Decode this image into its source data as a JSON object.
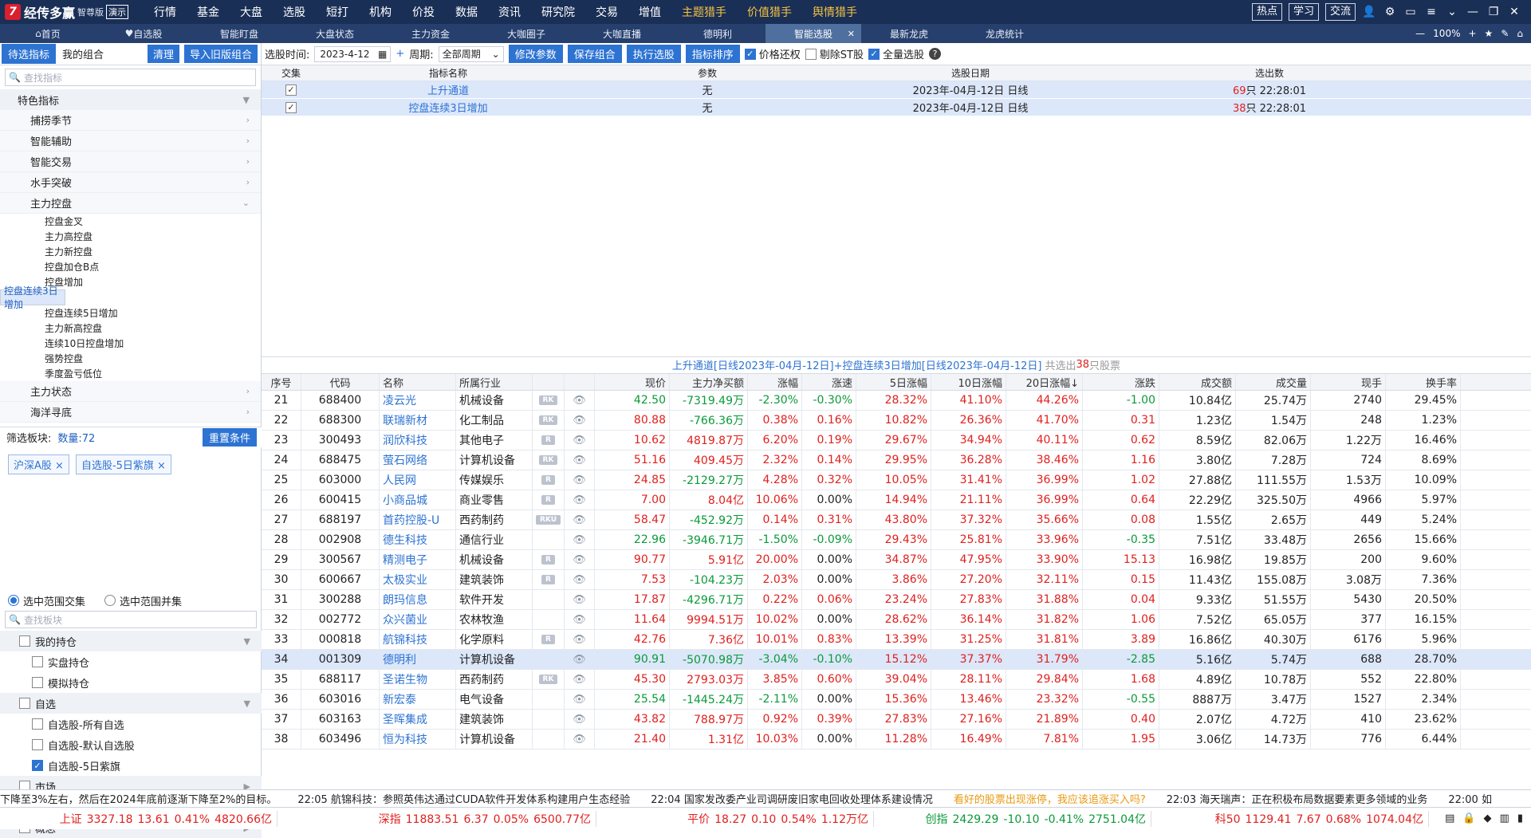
{
  "app": {
    "logo_text": "经传多赢",
    "edition": "智尊版",
    "demo": "演示"
  },
  "menu": [
    {
      "label": "行情",
      "gold": false
    },
    {
      "label": "基金",
      "gold": false
    },
    {
      "label": "大盘",
      "gold": false
    },
    {
      "label": "选股",
      "gold": false
    },
    {
      "label": "短打",
      "gold": false
    },
    {
      "label": "机构",
      "gold": false
    },
    {
      "label": "价投",
      "gold": false
    },
    {
      "label": "数据",
      "gold": false
    },
    {
      "label": "资讯",
      "gold": false
    },
    {
      "label": "研究院",
      "gold": false
    },
    {
      "label": "交易",
      "gold": false
    },
    {
      "label": "增值",
      "gold": false
    },
    {
      "label": "主题猎手",
      "gold": true
    },
    {
      "label": "价值猎手",
      "gold": true
    },
    {
      "label": "舆情猎手",
      "gold": true
    }
  ],
  "top_buttons": [
    "热点",
    "学习",
    "交流"
  ],
  "tabs": [
    {
      "label": "首页",
      "active": false
    },
    {
      "label": "自选股",
      "active": false
    },
    {
      "label": "智能盯盘",
      "active": false
    },
    {
      "label": "大盘状态",
      "active": false
    },
    {
      "label": "主力资金",
      "active": false
    },
    {
      "label": "大咖圈子",
      "active": false
    },
    {
      "label": "大咖直播",
      "active": false
    },
    {
      "label": "德明利",
      "active": false
    },
    {
      "label": "智能选股",
      "active": true
    },
    {
      "label": "最新龙虎",
      "active": false
    },
    {
      "label": "龙虎统计",
      "active": false
    }
  ],
  "zoom": "100%",
  "left": {
    "tabs": [
      "待选指标",
      "我的组合"
    ],
    "buttons": [
      "清理",
      "导入旧版组合"
    ],
    "search_placeholder": "查找指标",
    "tree_top": "特色指标",
    "groups_before": [
      "捕捞季节",
      "智能辅助",
      "智能交易",
      "水手突破"
    ],
    "open_group": "主力控盘",
    "leaves": [
      {
        "label": "控盘金叉",
        "sel": false
      },
      {
        "label": "主力高控盘",
        "sel": false
      },
      {
        "label": "主力新控盘",
        "sel": false
      },
      {
        "label": "控盘加仓B点",
        "sel": false
      },
      {
        "label": "控盘增加",
        "sel": false
      },
      {
        "label": "控盘连续3日增加",
        "sel": true
      },
      {
        "label": "控盘连续5日增加",
        "sel": false
      },
      {
        "label": "主力新高控盘",
        "sel": false
      },
      {
        "label": "连续10日控盘增加",
        "sel": false
      },
      {
        "label": "强势控盘",
        "sel": false
      },
      {
        "label": "季度盈亏低位",
        "sel": false
      }
    ],
    "groups_after": [
      "主力状态",
      "海洋寻底"
    ],
    "filter_label": "筛选板块:",
    "filter_count": "数量:72",
    "reset": "重置条件",
    "tags": [
      "沪深A股",
      "自选股-5日紫旗"
    ],
    "radio1": "选中范围交集",
    "radio2": "选中范围并集",
    "search2_placeholder": "查找板块",
    "boards": [
      {
        "label": "我的持仓",
        "level": "top",
        "checked": false,
        "chev": "▼"
      },
      {
        "label": "实盘持仓",
        "level": "sub",
        "checked": false,
        "chev": ""
      },
      {
        "label": "模拟持仓",
        "level": "sub",
        "checked": false,
        "chev": ""
      },
      {
        "label": "自选",
        "level": "top",
        "checked": false,
        "chev": "▼"
      },
      {
        "label": "自选股-所有自选",
        "level": "sub",
        "checked": false,
        "chev": ""
      },
      {
        "label": "自选股-默认自选股",
        "level": "sub",
        "checked": false,
        "chev": ""
      },
      {
        "label": "自选股-5日紫旗",
        "level": "sub",
        "checked": true,
        "chev": ""
      },
      {
        "label": "市场",
        "level": "top",
        "checked": false,
        "chev": "▶"
      },
      {
        "label": "行业",
        "level": "top",
        "checked": false,
        "chev": "▶"
      },
      {
        "label": "概念",
        "level": "top",
        "checked": false,
        "chev": "▶"
      }
    ]
  },
  "toolbar": {
    "time_label": "选股时间:",
    "date": "2023-4-12",
    "period_label": "周期:",
    "period": "全部周期",
    "buttons": [
      "修改参数",
      "保存组合",
      "执行选股",
      "指标排序"
    ],
    "chk1": "价格还权",
    "chk2": "剔除ST股",
    "chk3": "全量选股"
  },
  "formula_head": [
    "交集",
    "指标名称",
    "参数",
    "选股日期",
    "选出数"
  ],
  "formulas": [
    {
      "name": "上升通道",
      "param": "无",
      "date": "2023年-04月-12日 日线",
      "count": "69",
      "unit": "只 22:28:01"
    },
    {
      "name": "控盘连续3日增加",
      "param": "无",
      "date": "2023年-04月-12日 日线",
      "count": "38",
      "unit": "只 22:28:01"
    }
  ],
  "cond": {
    "text": "上升通道[日线2023年-04月-12日]+控盘连续3日增加[日线2023年-04月-12日]",
    "pre": "共选出",
    "count": "38",
    "post": "只股票"
  },
  "grid_head": [
    "序号",
    "代码",
    "名称",
    "所属行业",
    "",
    "",
    "现价",
    "主力净买额",
    "涨幅",
    "涨速",
    "5日涨幅",
    "10日涨幅",
    "20日涨幅↓",
    "涨跌",
    "成交额",
    "成交量",
    "现手",
    "换手率"
  ],
  "rows": [
    {
      "n": "21",
      "code": "688400",
      "name": "凌云光",
      "ind": "机械设备",
      "badge": "RK",
      "price": "42.50",
      "net": "-7319.49万",
      "chg": "-2.30%",
      "spd": "-0.30%",
      "d5": "28.32%",
      "d10": "41.10%",
      "d20": "44.26%",
      "up": "-1.00",
      "amt": "10.84亿",
      "vol": "25.74万",
      "hand": "2740",
      "turn": "29.45%"
    },
    {
      "n": "22",
      "code": "688300",
      "name": "联瑞新材",
      "ind": "化工制品",
      "badge": "RK",
      "price": "80.88",
      "net": "-766.36万",
      "chg": "0.38%",
      "spd": "0.16%",
      "d5": "10.82%",
      "d10": "26.36%",
      "d20": "41.70%",
      "up": "0.31",
      "amt": "1.23亿",
      "vol": "1.54万",
      "hand": "248",
      "turn": "1.23%"
    },
    {
      "n": "23",
      "code": "300493",
      "name": "润欣科技",
      "ind": "其他电子",
      "badge": "R",
      "price": "10.62",
      "net": "4819.87万",
      "chg": "6.20%",
      "spd": "0.19%",
      "d5": "29.67%",
      "d10": "34.94%",
      "d20": "40.11%",
      "up": "0.62",
      "amt": "8.59亿",
      "vol": "82.06万",
      "hand": "1.22万",
      "turn": "16.46%"
    },
    {
      "n": "24",
      "code": "688475",
      "name": "萤石网络",
      "ind": "计算机设备",
      "badge": "RK",
      "price": "51.16",
      "net": "409.45万",
      "chg": "2.32%",
      "spd": "0.14%",
      "d5": "29.95%",
      "d10": "36.28%",
      "d20": "38.46%",
      "up": "1.16",
      "amt": "3.80亿",
      "vol": "7.28万",
      "hand": "724",
      "turn": "8.69%"
    },
    {
      "n": "25",
      "code": "603000",
      "name": "人民网",
      "ind": "传媒娱乐",
      "badge": "R",
      "price": "24.85",
      "net": "-2129.27万",
      "chg": "4.28%",
      "spd": "0.32%",
      "d5": "10.05%",
      "d10": "31.41%",
      "d20": "36.99%",
      "up": "1.02",
      "amt": "27.88亿",
      "vol": "111.55万",
      "hand": "1.53万",
      "turn": "10.09%"
    },
    {
      "n": "26",
      "code": "600415",
      "name": "小商品城",
      "ind": "商业零售",
      "badge": "R",
      "price": "7.00",
      "net": "8.04亿",
      "chg": "10.06%",
      "spd": "0.00%",
      "d5": "14.94%",
      "d10": "21.11%",
      "d20": "36.99%",
      "up": "0.64",
      "amt": "22.29亿",
      "vol": "325.50万",
      "hand": "4966",
      "turn": "5.97%"
    },
    {
      "n": "27",
      "code": "688197",
      "name": "首药控股-U",
      "ind": "西药制药",
      "badge": "RKU",
      "price": "58.47",
      "net": "-452.92万",
      "chg": "0.14%",
      "spd": "0.31%",
      "d5": "43.80%",
      "d10": "37.32%",
      "d20": "35.66%",
      "up": "0.08",
      "amt": "1.55亿",
      "vol": "2.65万",
      "hand": "449",
      "turn": "5.24%"
    },
    {
      "n": "28",
      "code": "002908",
      "name": "德生科技",
      "ind": "通信行业",
      "badge": "",
      "price": "22.96",
      "net": "-3946.71万",
      "chg": "-1.50%",
      "spd": "-0.09%",
      "d5": "29.43%",
      "d10": "25.81%",
      "d20": "33.96%",
      "up": "-0.35",
      "amt": "7.51亿",
      "vol": "33.48万",
      "hand": "2656",
      "turn": "15.66%"
    },
    {
      "n": "29",
      "code": "300567",
      "name": "精测电子",
      "ind": "机械设备",
      "badge": "R",
      "price": "90.77",
      "net": "5.91亿",
      "chg": "20.00%",
      "spd": "0.00%",
      "d5": "34.87%",
      "d10": "47.95%",
      "d20": "33.90%",
      "up": "15.13",
      "amt": "16.98亿",
      "vol": "19.85万",
      "hand": "200",
      "turn": "9.60%"
    },
    {
      "n": "30",
      "code": "600667",
      "name": "太极实业",
      "ind": "建筑装饰",
      "badge": "R",
      "price": "7.53",
      "net": "-104.23万",
      "chg": "2.03%",
      "spd": "0.00%",
      "d5": "3.86%",
      "d10": "27.20%",
      "d20": "32.11%",
      "up": "0.15",
      "amt": "11.43亿",
      "vol": "155.08万",
      "hand": "3.08万",
      "turn": "7.36%"
    },
    {
      "n": "31",
      "code": "300288",
      "name": "朗玛信息",
      "ind": "软件开发",
      "badge": "",
      "price": "17.87",
      "net": "-4296.71万",
      "chg": "0.22%",
      "spd": "0.06%",
      "d5": "23.24%",
      "d10": "27.83%",
      "d20": "31.88%",
      "up": "0.04",
      "amt": "9.33亿",
      "vol": "51.55万",
      "hand": "5430",
      "turn": "20.50%"
    },
    {
      "n": "32",
      "code": "002772",
      "name": "众兴菌业",
      "ind": "农林牧渔",
      "badge": "",
      "price": "11.64",
      "net": "9994.51万",
      "chg": "10.02%",
      "spd": "0.00%",
      "d5": "28.62%",
      "d10": "36.14%",
      "d20": "31.82%",
      "up": "1.06",
      "amt": "7.52亿",
      "vol": "65.05万",
      "hand": "377",
      "turn": "16.15%"
    },
    {
      "n": "33",
      "code": "000818",
      "name": "航锦科技",
      "ind": "化学原料",
      "badge": "R",
      "price": "42.76",
      "net": "7.36亿",
      "chg": "10.01%",
      "spd": "0.83%",
      "d5": "13.39%",
      "d10": "31.25%",
      "d20": "31.81%",
      "up": "3.89",
      "amt": "16.86亿",
      "vol": "40.30万",
      "hand": "6176",
      "turn": "5.96%"
    },
    {
      "n": "34",
      "code": "001309",
      "name": "德明利",
      "ind": "计算机设备",
      "badge": "",
      "price": "90.91",
      "net": "-5070.98万",
      "chg": "-3.04%",
      "spd": "-0.10%",
      "d5": "15.12%",
      "d10": "37.37%",
      "d20": "31.79%",
      "up": "-2.85",
      "amt": "5.16亿",
      "vol": "5.74万",
      "hand": "688",
      "turn": "28.70%",
      "hl": true
    },
    {
      "n": "35",
      "code": "688117",
      "name": "圣诺生物",
      "ind": "西药制药",
      "badge": "RK",
      "price": "45.30",
      "net": "2793.03万",
      "chg": "3.85%",
      "spd": "0.60%",
      "d5": "39.04%",
      "d10": "28.11%",
      "d20": "29.84%",
      "up": "1.68",
      "amt": "4.89亿",
      "vol": "10.78万",
      "hand": "552",
      "turn": "22.80%"
    },
    {
      "n": "36",
      "code": "603016",
      "name": "新宏泰",
      "ind": "电气设备",
      "badge": "",
      "price": "25.54",
      "net": "-1445.24万",
      "chg": "-2.11%",
      "spd": "0.00%",
      "d5": "15.36%",
      "d10": "13.46%",
      "d20": "23.32%",
      "up": "-0.55",
      "amt": "8887万",
      "vol": "3.47万",
      "hand": "1527",
      "turn": "2.34%"
    },
    {
      "n": "37",
      "code": "603163",
      "name": "圣晖集成",
      "ind": "建筑装饰",
      "badge": "",
      "price": "43.82",
      "net": "788.97万",
      "chg": "0.92%",
      "spd": "0.39%",
      "d5": "27.83%",
      "d10": "27.16%",
      "d20": "21.89%",
      "up": "0.40",
      "amt": "2.07亿",
      "vol": "4.72万",
      "hand": "410",
      "turn": "23.62%"
    },
    {
      "n": "38",
      "code": "603496",
      "name": "恒为科技",
      "ind": "计算机设备",
      "badge": "",
      "price": "21.40",
      "net": "1.31亿",
      "chg": "10.03%",
      "spd": "0.00%",
      "d5": "11.28%",
      "d10": "16.49%",
      "d20": "7.81%",
      "up": "1.95",
      "amt": "3.06亿",
      "vol": "14.73万",
      "hand": "776",
      "turn": "6.44%"
    }
  ],
  "news": [
    {
      "text": "下降至3%左右，然后在2024年底前逐渐下降至2%的目标。",
      "orange": false
    },
    {
      "text": "22:05 航锦科技：参照英伟达通过CUDA软件开发体系构建用户生态经验",
      "orange": false
    },
    {
      "text": "22:04 国家发改委产业司调研废旧家电回收处理体系建设情况",
      "orange": false
    },
    {
      "text": "看好的股票出现涨停，我应该追涨买入吗?",
      "orange": true
    },
    {
      "text": "22:03 海天瑞声：正在积极布局数据要素更多领域的业务",
      "orange": false
    },
    {
      "text": "22:00 如",
      "orange": false
    }
  ],
  "indices": [
    {
      "name": "上证",
      "val": "3327.18",
      "chg": "13.61",
      "pct": "0.41%",
      "amt": "4820.66亿"
    },
    {
      "name": "深指",
      "val": "11883.51",
      "chg": "6.37",
      "pct": "0.05%",
      "amt": "6500.77亿"
    },
    {
      "name": "平价",
      "val": "18.27",
      "chg": "0.10",
      "pct": "0.54%",
      "amt": "1.12万亿"
    },
    {
      "name": "创指",
      "val": "2429.29",
      "chg": "-10.10",
      "pct": "-0.41%",
      "amt": "2751.04亿"
    },
    {
      "name": "科50",
      "val": "1129.41",
      "chg": "7.67",
      "pct": "0.68%",
      "amt": "1074.04亿"
    }
  ]
}
